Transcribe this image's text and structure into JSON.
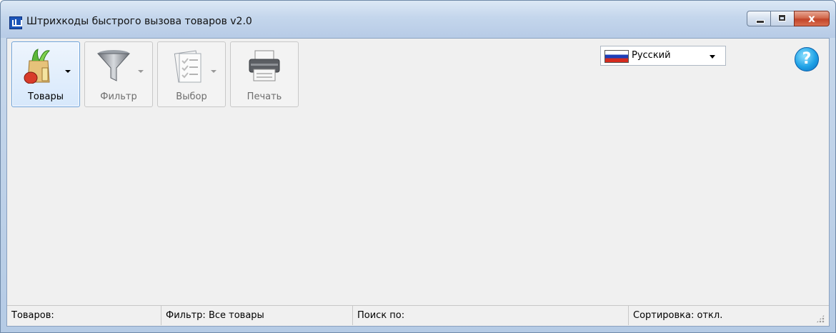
{
  "window": {
    "title": "Штрихкоды быстрого вызова товаров v2.0",
    "close_glyph": "x"
  },
  "toolbar": {
    "buttons": [
      {
        "label": "Товары",
        "icon": "groceries-bag-icon",
        "has_dropdown": true,
        "enabled": true,
        "active": true
      },
      {
        "label": "Фильтр",
        "icon": "funnel-filter-icon",
        "has_dropdown": true,
        "enabled": false,
        "active": false
      },
      {
        "label": "Выбор",
        "icon": "checklist-clipboard-icon",
        "has_dropdown": true,
        "enabled": false,
        "active": false
      },
      {
        "label": "Печать",
        "icon": "printer-icon",
        "has_dropdown": false,
        "enabled": false,
        "active": false
      }
    ]
  },
  "language": {
    "selected": "Русский",
    "flag": "russia-flag-icon"
  },
  "help": {
    "glyph": "?"
  },
  "statusbar": {
    "items_label": "Товаров:",
    "filter_label": "Фильтр: Все товары",
    "search_label": "Поиск по:",
    "sort_label": "Сортировка: откл."
  },
  "colors": {
    "accent_active_border": "#6aa0d9",
    "client_background": "#f0f0f0",
    "close_button": "#c2452a"
  }
}
